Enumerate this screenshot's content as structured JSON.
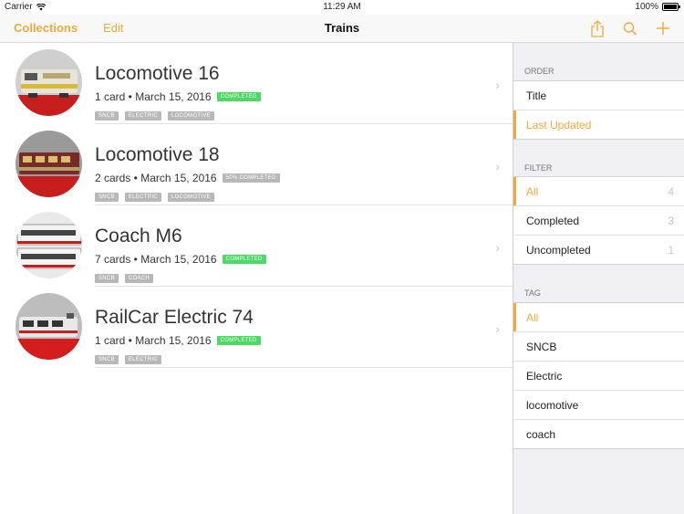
{
  "status_bar": {
    "carrier": "Carrier",
    "time": "11:29 AM",
    "battery": "100%",
    "battery_level": 1.0
  },
  "nav": {
    "collections": "Collections",
    "edit": "Edit",
    "title": "Trains"
  },
  "colors": {
    "accent": "#f2a93b",
    "completed": "#4cd964",
    "tag_bg": "#b8b8b8"
  },
  "icons": [
    "share-icon",
    "search-icon",
    "add-icon",
    "chevron-right-icon",
    "wifi-icon",
    "battery-icon"
  ],
  "collections": [
    {
      "name": "Locomotive 16",
      "meta": "1 card • March 15, 2016",
      "status": "COMPLETED",
      "tags": [
        "SNCB",
        "ELECTRIC",
        "LOCOMOTIVE"
      ]
    },
    {
      "name": "Locomotive 18",
      "meta": "2 cards • March 15, 2016",
      "status": "50% COMPLETED",
      "tags": [
        "SNCB",
        "ELECTRIC",
        "LOCOMOTIVE"
      ]
    },
    {
      "name": "Coach M6",
      "meta": "7 cards • March 15, 2016",
      "status": "COMPLETED",
      "tags": [
        "SNCB",
        "COACH"
      ]
    },
    {
      "name": "RailCar Electric 74",
      "meta": "1 card • March 15, 2016",
      "status": "COMPLETED",
      "tags": [
        "SNCB",
        "ELECTRIC"
      ]
    }
  ],
  "sidebar": {
    "order": {
      "header": "ORDER",
      "items": [
        {
          "label": "Title"
        },
        {
          "label": "Last Updated",
          "selected": true
        }
      ]
    },
    "filter": {
      "header": "FILTER",
      "items": [
        {
          "label": "All",
          "count": "4",
          "selected": true
        },
        {
          "label": "Completed",
          "count": "3"
        },
        {
          "label": "Uncompleted",
          "count": "1"
        }
      ]
    },
    "tag": {
      "header": "TAG",
      "items": [
        {
          "label": "All",
          "selected": true
        },
        {
          "label": "SNCB"
        },
        {
          "label": "Electric"
        },
        {
          "label": "locomotive"
        },
        {
          "label": "coach"
        }
      ]
    }
  }
}
